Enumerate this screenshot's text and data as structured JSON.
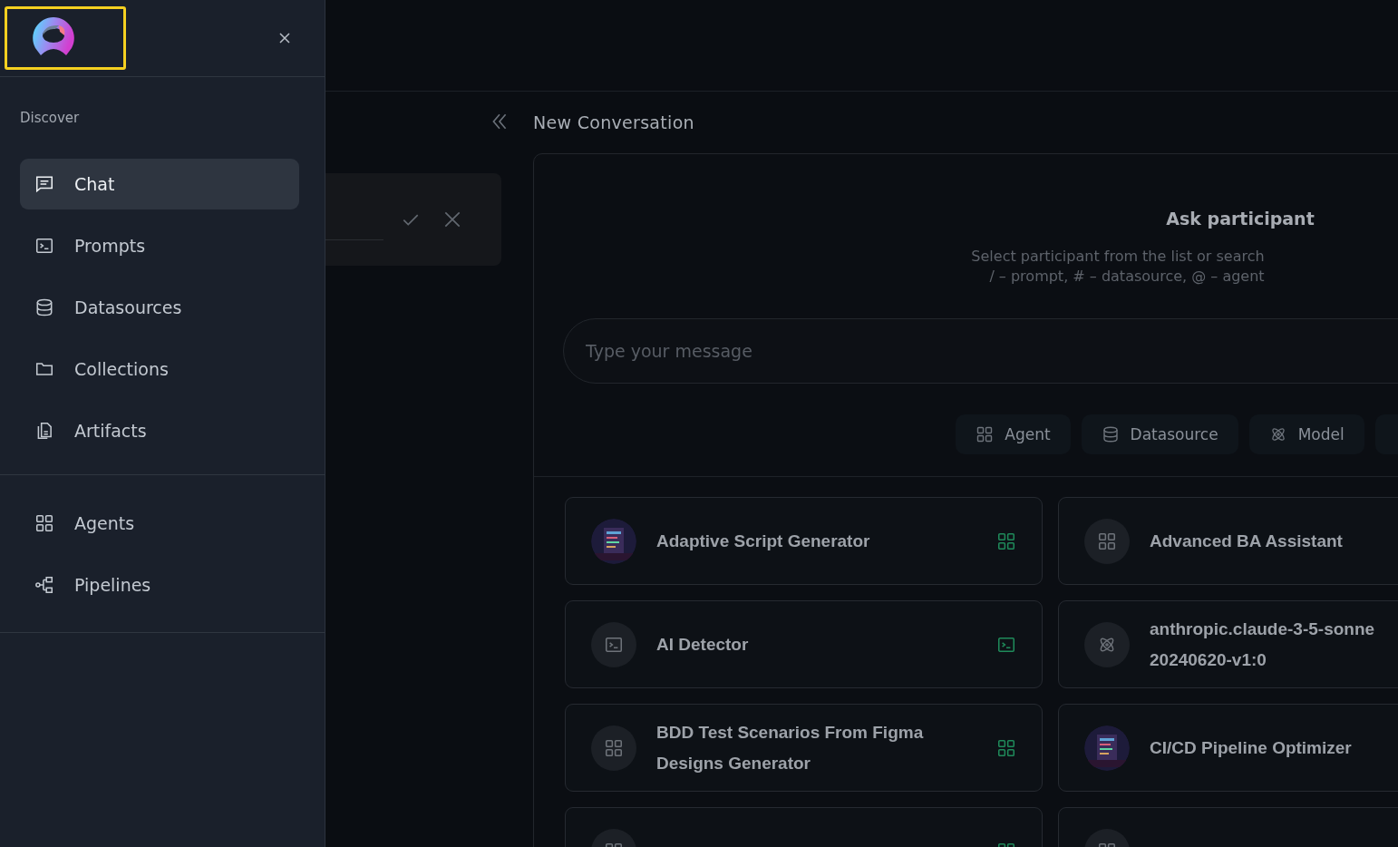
{
  "sidebar": {
    "logo": {
      "highlighted": true
    },
    "section_label": "Discover",
    "groups": [
      [
        {
          "label": "Chat",
          "kind": "chat",
          "selected": true
        },
        {
          "label": "Prompts",
          "kind": "prompt",
          "selected": false
        },
        {
          "label": "Datasources",
          "kind": "datasource",
          "selected": false
        },
        {
          "label": "Collections",
          "kind": "collection",
          "selected": false
        },
        {
          "label": "Artifacts",
          "kind": "artifact",
          "selected": false
        }
      ],
      [
        {
          "label": "Agents",
          "kind": "agent",
          "selected": false
        },
        {
          "label": "Pipelines",
          "kind": "pipeline",
          "selected": false
        }
      ]
    ]
  },
  "header": {
    "title": "New Conversation"
  },
  "chat": {
    "heading": "Ask participant",
    "hint_lines": [
      "Select participant from the list or search",
      "/ – prompt, # – datasource, @ – agent"
    ],
    "input": {
      "placeholder": "Type your message"
    },
    "chips": [
      {
        "label": "Agent",
        "kind": "agent"
      },
      {
        "label": "Datasource",
        "kind": "datasource"
      },
      {
        "label": "Model",
        "kind": "model"
      },
      {
        "kind": "other"
      }
    ],
    "card_rows": [
      [
        {
          "title_lines": [
            "Adaptive Script Generator"
          ],
          "kind": "agent",
          "picture": true
        },
        {
          "title_lines": [
            "Advanced BA Assistant"
          ],
          "kind": "agent",
          "picture": false
        }
      ],
      [
        {
          "title_lines": [
            "AI Detector"
          ],
          "kind": "prompt",
          "picture": false
        },
        {
          "title_lines": [
            "anthropic.claude-3-5-sonne",
            "20240620-v1:0"
          ],
          "kind": "model",
          "picture": false
        }
      ],
      [
        {
          "title_lines": [
            "BDD Test Scenarios From Figma",
            "Designs Generator"
          ],
          "kind": "agent",
          "picture": false
        },
        {
          "title_lines": [
            "CI/CD Pipeline Optimizer"
          ],
          "picture": true
        }
      ],
      [
        {
          "kind": "agent",
          "picture": false
        },
        {
          "kind": "agent",
          "picture": false
        }
      ]
    ]
  }
}
